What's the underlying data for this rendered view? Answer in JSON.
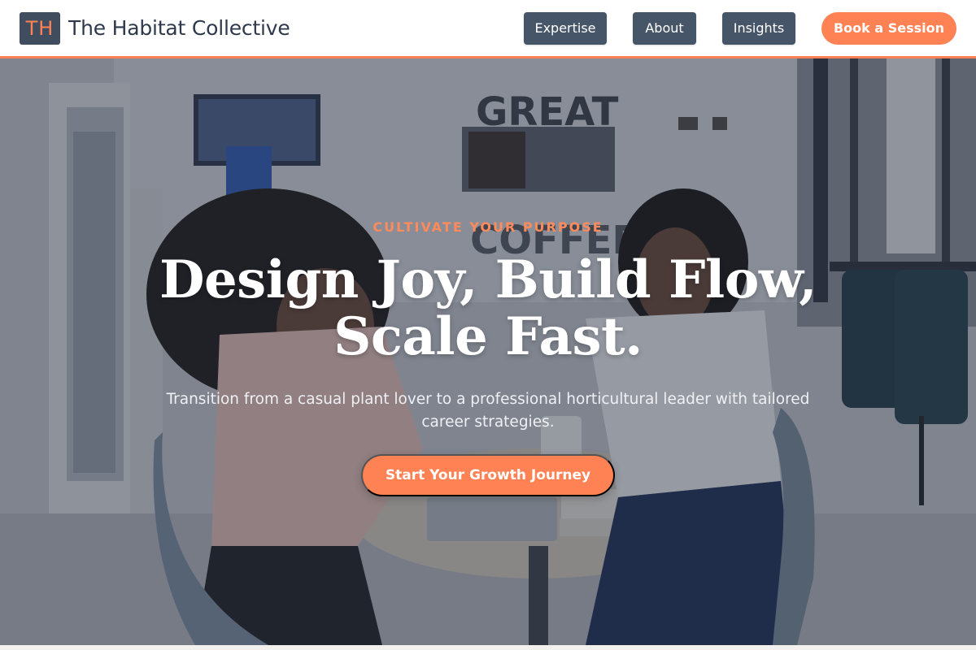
{
  "brand": {
    "logo_initials": "TH",
    "name": "The Habitat Collective"
  },
  "nav": {
    "items": [
      {
        "label": "Expertise"
      },
      {
        "label": "About"
      },
      {
        "label": "Insights"
      }
    ],
    "cta_label": "Book a Session"
  },
  "hero": {
    "eyebrow": "CULTIVATE YOUR PURPOSE",
    "headline_line1": "Design Joy, Build Flow,",
    "headline_line2": "Scale Fast.",
    "subhead": "Transition from a casual plant lover to a professional horticultural leader with tailored career strategies.",
    "cta_label": "Start Your Growth Journey"
  },
  "colors": {
    "accent": "#ff8255",
    "nav_button": "#465567",
    "brand_text": "#2e3a4b"
  }
}
